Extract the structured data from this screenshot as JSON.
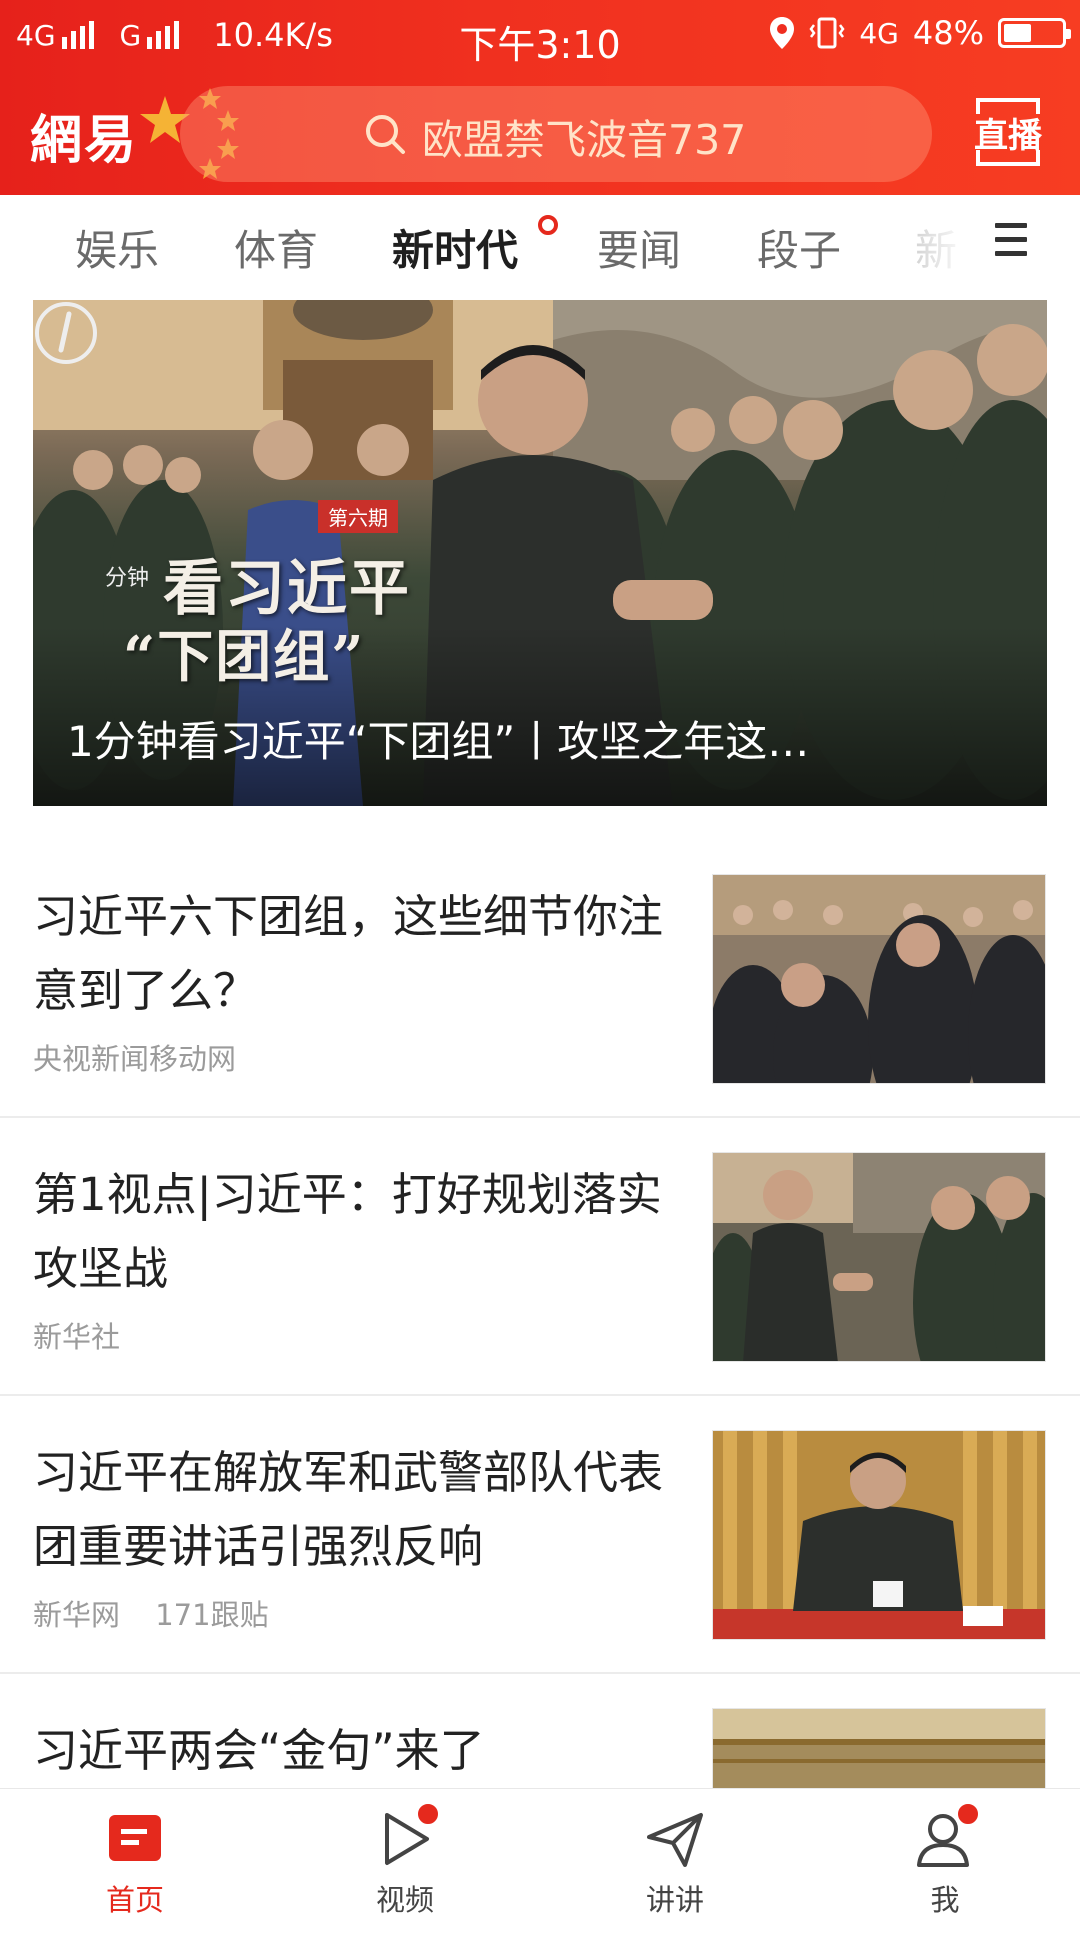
{
  "status_bar": {
    "net1": "4G",
    "net2": "G",
    "speed": "10.4K/s",
    "time": "下午3:10",
    "net3": "4G",
    "battery": "48%",
    "battery_level": 0.48
  },
  "header": {
    "brand": "網易",
    "search_placeholder": "欧盟禁飞波音737",
    "live_label": "直播"
  },
  "tabs": [
    {
      "label": "娱乐",
      "active": false
    },
    {
      "label": "体育",
      "active": false
    },
    {
      "label": "新时代",
      "active": true,
      "badge": true
    },
    {
      "label": "要闻",
      "active": false
    },
    {
      "label": "段子",
      "active": false
    },
    {
      "label": "新",
      "active": false
    }
  ],
  "hero": {
    "badge": "第六期",
    "logo_text": "分钟",
    "overlay_title": "看习近平",
    "overlay_sub": "“下团组”",
    "caption": "1分钟看习近平“下团组”丨攻坚之年这…"
  },
  "news": [
    {
      "title": "习近平六下团组，这些细节你注意到了么？",
      "source": "央视新闻移动网",
      "comments": ""
    },
    {
      "title": "第1视点|习近平：打好规划落实攻坚战",
      "source": "新华社",
      "comments": ""
    },
    {
      "title": "习近平在解放军和武警部队代表团重要讲话引强烈反响",
      "source": "新华网",
      "comments": "171跟贴"
    },
    {
      "title": "习近平两会“金句”来了",
      "source": "",
      "comments": ""
    }
  ],
  "bottom_nav": [
    {
      "label": "首页",
      "icon": "home-icon",
      "active": true,
      "dot": false
    },
    {
      "label": "视频",
      "icon": "video-play-icon",
      "active": false,
      "dot": true
    },
    {
      "label": "讲讲",
      "icon": "paper-plane-icon",
      "active": false,
      "dot": false
    },
    {
      "label": "我",
      "icon": "user-icon",
      "active": false,
      "dot": true
    }
  ],
  "colors": {
    "accent": "#e5291d",
    "header_bg": "#ef2d1f"
  }
}
